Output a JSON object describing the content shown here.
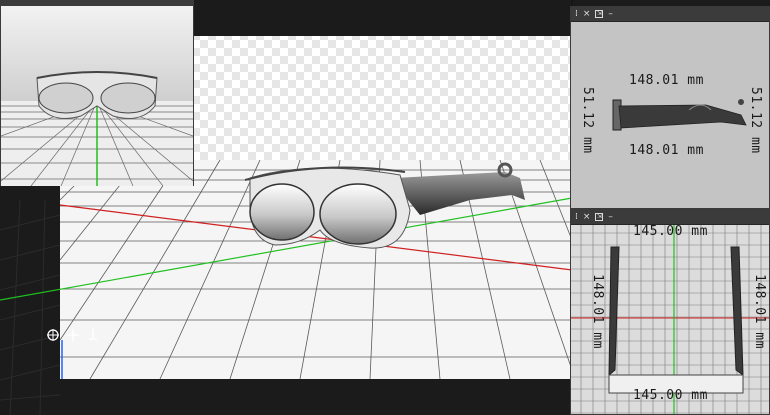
{
  "scene": {
    "gizmo_icons": [
      "orbit-icon",
      "pan-icon",
      "zoom-icon"
    ],
    "colors": {
      "x_axis": "#d02020",
      "y_axis": "#20c020",
      "z_axis": "#2060ff",
      "background": "#1b1b1b"
    }
  },
  "side_view": {
    "dim_top": "148.01 mm",
    "dim_bottom": "148.01 mm",
    "dim_left": "51.12 mm",
    "dim_right": "51.12 mm"
  },
  "top_view": {
    "dim_top": "145.00 mm",
    "dim_bottom": "145.00 mm",
    "dim_left": "148.01 mm",
    "dim_right": "148.01 mm"
  }
}
